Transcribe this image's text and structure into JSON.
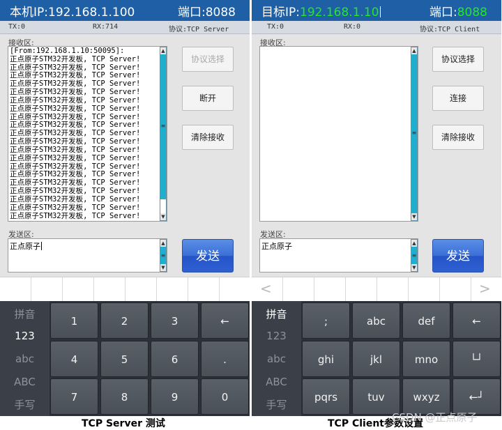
{
  "left": {
    "header": {
      "ip_label": "本机IP:",
      "ip_value": "192.168.1.100",
      "port_label": "端口:",
      "port_value": "8088"
    },
    "status": {
      "tx": "TX:0",
      "rx": "RX:714",
      "protocol": "协议:TCP Server"
    },
    "recv_label": "接收区:",
    "recv_lines": [
      "[From:192.168.1.10:50095]:",
      "正点原子STM32开发板, TCP Server!",
      "正点原子STM32开发板, TCP Server!",
      "正点原子STM32开发板, TCP Server!",
      "正点原子STM32开发板, TCP Server!",
      "正点原子STM32开发板, TCP Server!",
      "正点原子STM32开发板, TCP Server!",
      "正点原子STM32开发板, TCP Server!",
      "正点原子STM32开发板, TCP Server!",
      "正点原子STM32开发板, TCP Server!",
      "正点原子STM32开发板, TCP Server!",
      "正点原子STM32开发板, TCP Server!",
      "正点原子STM32开发板, TCP Server!",
      "正点原子STM32开发板, TCP Server!",
      "正点原子STM32开发板, TCP Server!",
      "正点原子STM32开发板, TCP Server!",
      "正点原子STM32开发板, TCP Server!",
      "正点原子STM32开发板, TCP Server!",
      "正点原子STM32开发板, TCP Server!",
      "正点原子STM32开发板, TCP Server!",
      "正点原子STM32开发板, TCP Server!"
    ],
    "buttons": {
      "protocol": "协议选择",
      "connect": "断开",
      "clear": "清除接收"
    },
    "send_label": "发送区:",
    "send_value": "正点原子",
    "send_button": "发送",
    "ime_modes": [
      "拼音",
      "123",
      "abc",
      "ABC",
      "手写"
    ],
    "keys": [
      "1",
      "2",
      "3",
      "←",
      "4",
      "5",
      "6",
      ".",
      "7",
      "8",
      "9",
      "0"
    ],
    "caption": "TCP Server 测试"
  },
  "right": {
    "header": {
      "ip_label": "目标IP:",
      "ip_value": "192.168.1.10",
      "port_label": "端口:",
      "port_value": "8088"
    },
    "status": {
      "tx": "TX:0",
      "rx": "RX:0",
      "protocol": "协议:TCP Client"
    },
    "recv_label": "接收区:",
    "buttons": {
      "protocol": "协议选择",
      "connect": "连接",
      "clear": "清除接收"
    },
    "send_label": "发送区:",
    "send_value": "正点原子",
    "send_button": "发送",
    "ime_modes": [
      "拼音",
      "123",
      "abc",
      "ABC",
      "手写"
    ],
    "keys": [
      ";",
      "abc",
      "def",
      "←",
      "ghi",
      "jkl",
      "mno",
      "└┘",
      "pqrs",
      "tuv",
      "wxyz",
      "←┘"
    ],
    "cand_prev": "<",
    "cand_next": ">",
    "caption": "TCP Client参数设置"
  },
  "watermark": "CSDN @正点原子",
  "colors": {
    "header_bg": "#1f5fa6",
    "highlight_green": "#22e822",
    "scrollbar": "#1fb0d0",
    "send_button": "#2f60d2",
    "keyboard_bg": "#2c3038"
  }
}
